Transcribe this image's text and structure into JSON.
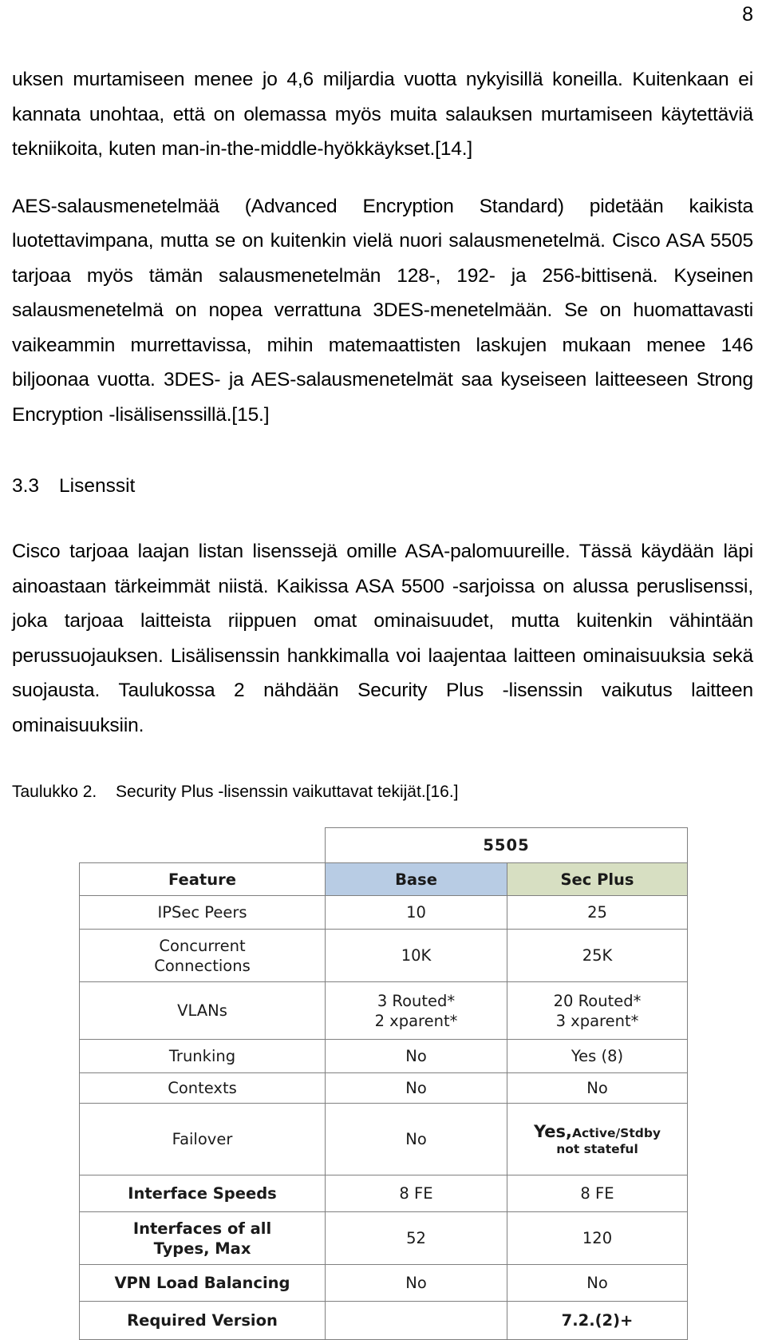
{
  "page": {
    "number": "8"
  },
  "paragraphs": {
    "p1": "uksen murtamiseen menee jo 4,6 miljardia vuotta nykyisillä koneilla. Kuitenkaan ei kannata unohtaa, että on olemassa myös muita salauksen murtamiseen käytettäviä tekniikoita, kuten man-in-the-middle-hyökkäykset.[14.]",
    "p2": "AES-salausmenetelmää (Advanced Encryption Standard) pidetään kaikista luotettavimpana, mutta se on kuitenkin vielä nuori salausmenetelmä. Cisco ASA 5505 tarjoaa myös tämän salausmenetelmän 128-, 192- ja 256-bittisenä. Kyseinen salausmenetelmä on nopea verrattuna 3DES-menetelmään. Se on huomattavasti vaikeammin murrettavissa, mihin matemaattisten laskujen mukaan menee 146 biljoonaa vuotta. 3DES- ja AES-salausmenetelmät saa kyseiseen laitteeseen Strong Encryption -lisälisenssillä.[15.]",
    "p3": "Cisco tarjoaa laajan listan lisenssejä omille ASA-palomuureille. Tässä käydään läpi ainoastaan tärkeimmät niistä. Kaikissa ASA 5500 -sarjoissa on alussa peruslisenssi, joka tarjoaa laitteista riippuen omat ominaisuudet, mutta kuitenkin vähintään perussuojauksen. Lisälisenssin hankkimalla voi laajentaa laitteen ominaisuuksia sekä suojausta. Taulukossa 2 nähdään Security Plus -lisenssin vaikutus laitteen ominaisuuksiin."
  },
  "heading": {
    "number": "3.3",
    "title": "Lisenssit"
  },
  "table_caption": {
    "label": "Taulukko 2.",
    "text": "Security Plus -lisenssin vaikuttavat tekijät.[16.]"
  },
  "spec_table": {
    "group_header": "5505",
    "columns": [
      "Feature",
      "Base",
      "Sec Plus"
    ],
    "rows": [
      {
        "feature": "IPSec Peers",
        "base": "10",
        "sec": "25"
      },
      {
        "feature_line1": "Concurrent",
        "feature_line2": "Connections",
        "base": "10K",
        "sec": "25K"
      },
      {
        "feature": "VLANs",
        "base_line1": "3 Routed*",
        "base_line2": "2 xparent*",
        "sec_line1": "20 Routed*",
        "sec_line2": "3 xparent*"
      },
      {
        "feature": "Trunking",
        "base": "No",
        "sec": "Yes (8)"
      },
      {
        "feature": "Contexts",
        "base": "No",
        "sec": "No"
      },
      {
        "feature": "Failover",
        "base": "No",
        "sec_main": "Yes,",
        "sec_sub1": "Active/Stdby",
        "sec_sub2": "not stateful"
      },
      {
        "feature": "Interface Speeds",
        "base": "8 FE",
        "sec": "8 FE"
      },
      {
        "feature_line1": "Interfaces of all",
        "feature_line2": "Types, Max",
        "base": "52",
        "sec": "120"
      },
      {
        "feature": "VPN Load  Balancing",
        "base": "No",
        "sec": "No"
      },
      {
        "feature": "Required Version",
        "base": "",
        "sec": "7.2.(2)+"
      }
    ],
    "colors": {
      "base_fill": "#b8cce4",
      "sec_fill": "#d7dfc2",
      "header_fill": "#f0f0f0",
      "border": "#808080",
      "dim_text": "#8a8a8a"
    }
  }
}
